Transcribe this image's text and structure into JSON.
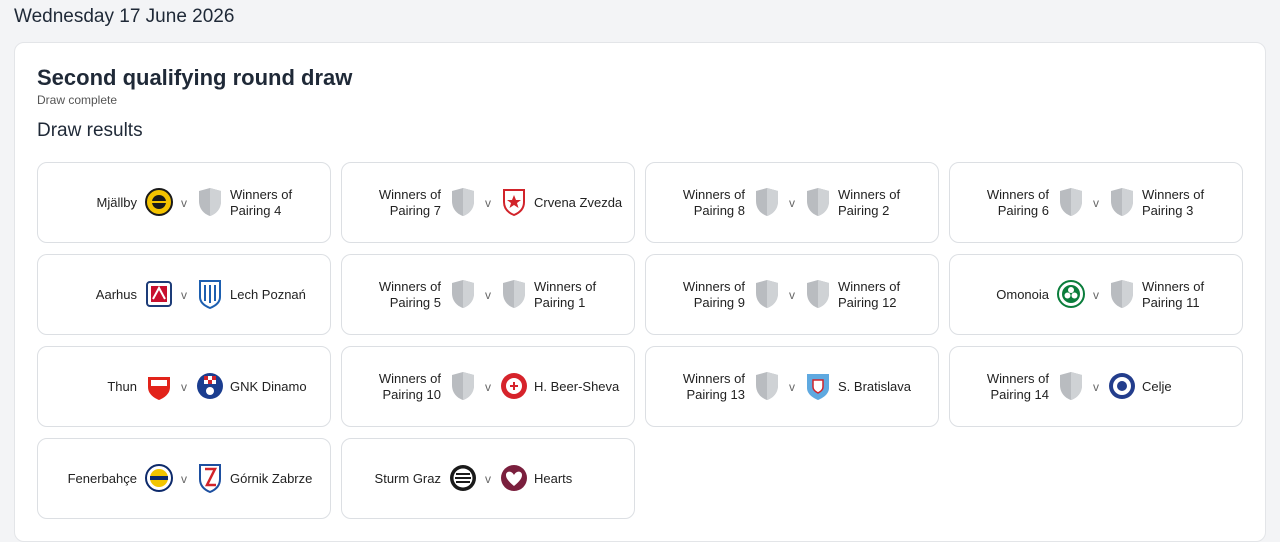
{
  "date": "Wednesday 17 June 2026",
  "title": "Second qualifying round draw",
  "status": "Draw complete",
  "section": "Draw results",
  "versus": "v",
  "ties": [
    {
      "home": {
        "name": "Mjällby",
        "crest": "mjallby-crest"
      },
      "away": {
        "name": "Winners of Pairing 4",
        "crest": "placeholder-shield"
      }
    },
    {
      "home": {
        "name": "Winners of Pairing 7",
        "crest": "placeholder-shield"
      },
      "away": {
        "name": "Crvena Zvezda",
        "crest": "crvena-zvezda-crest"
      }
    },
    {
      "home": {
        "name": "Winners of Pairing 8",
        "crest": "placeholder-shield"
      },
      "away": {
        "name": "Winners of Pairing 2",
        "crest": "placeholder-shield"
      }
    },
    {
      "home": {
        "name": "Winners of Pairing 6",
        "crest": "placeholder-shield"
      },
      "away": {
        "name": "Winners of Pairing 3",
        "crest": "placeholder-shield"
      }
    },
    {
      "home": {
        "name": "Aarhus",
        "crest": "aarhus-crest"
      },
      "away": {
        "name": "Lech Poznań",
        "crest": "lech-poznan-crest"
      }
    },
    {
      "home": {
        "name": "Winners of Pairing 5",
        "crest": "placeholder-shield"
      },
      "away": {
        "name": "Winners of Pairing 1",
        "crest": "placeholder-shield"
      }
    },
    {
      "home": {
        "name": "Winners of Pairing 9",
        "crest": "placeholder-shield"
      },
      "away": {
        "name": "Winners of Pairing 12",
        "crest": "placeholder-shield"
      }
    },
    {
      "home": {
        "name": "Omonoia",
        "crest": "omonoia-crest"
      },
      "away": {
        "name": "Winners of Pairing 11",
        "crest": "placeholder-shield"
      }
    },
    {
      "home": {
        "name": "Thun",
        "crest": "thun-crest"
      },
      "away": {
        "name": "GNK Dinamo",
        "crest": "dinamo-crest"
      }
    },
    {
      "home": {
        "name": "Winners of Pairing 10",
        "crest": "placeholder-shield"
      },
      "away": {
        "name": "H. Beer-Sheva",
        "crest": "beer-sheva-crest"
      }
    },
    {
      "home": {
        "name": "Winners of Pairing 13",
        "crest": "placeholder-shield"
      },
      "away": {
        "name": "S. Bratislava",
        "crest": "bratislava-crest"
      }
    },
    {
      "home": {
        "name": "Winners of Pairing 14",
        "crest": "placeholder-shield"
      },
      "away": {
        "name": "Celje",
        "crest": "celje-crest"
      }
    },
    {
      "home": {
        "name": "Fenerbahçe",
        "crest": "fenerbahce-crest"
      },
      "away": {
        "name": "Górnik Zabrze",
        "crest": "gornik-crest"
      }
    },
    {
      "home": {
        "name": "Sturm Graz",
        "crest": "sturm-graz-crest"
      },
      "away": {
        "name": "Hearts",
        "crest": "hearts-crest"
      }
    }
  ]
}
